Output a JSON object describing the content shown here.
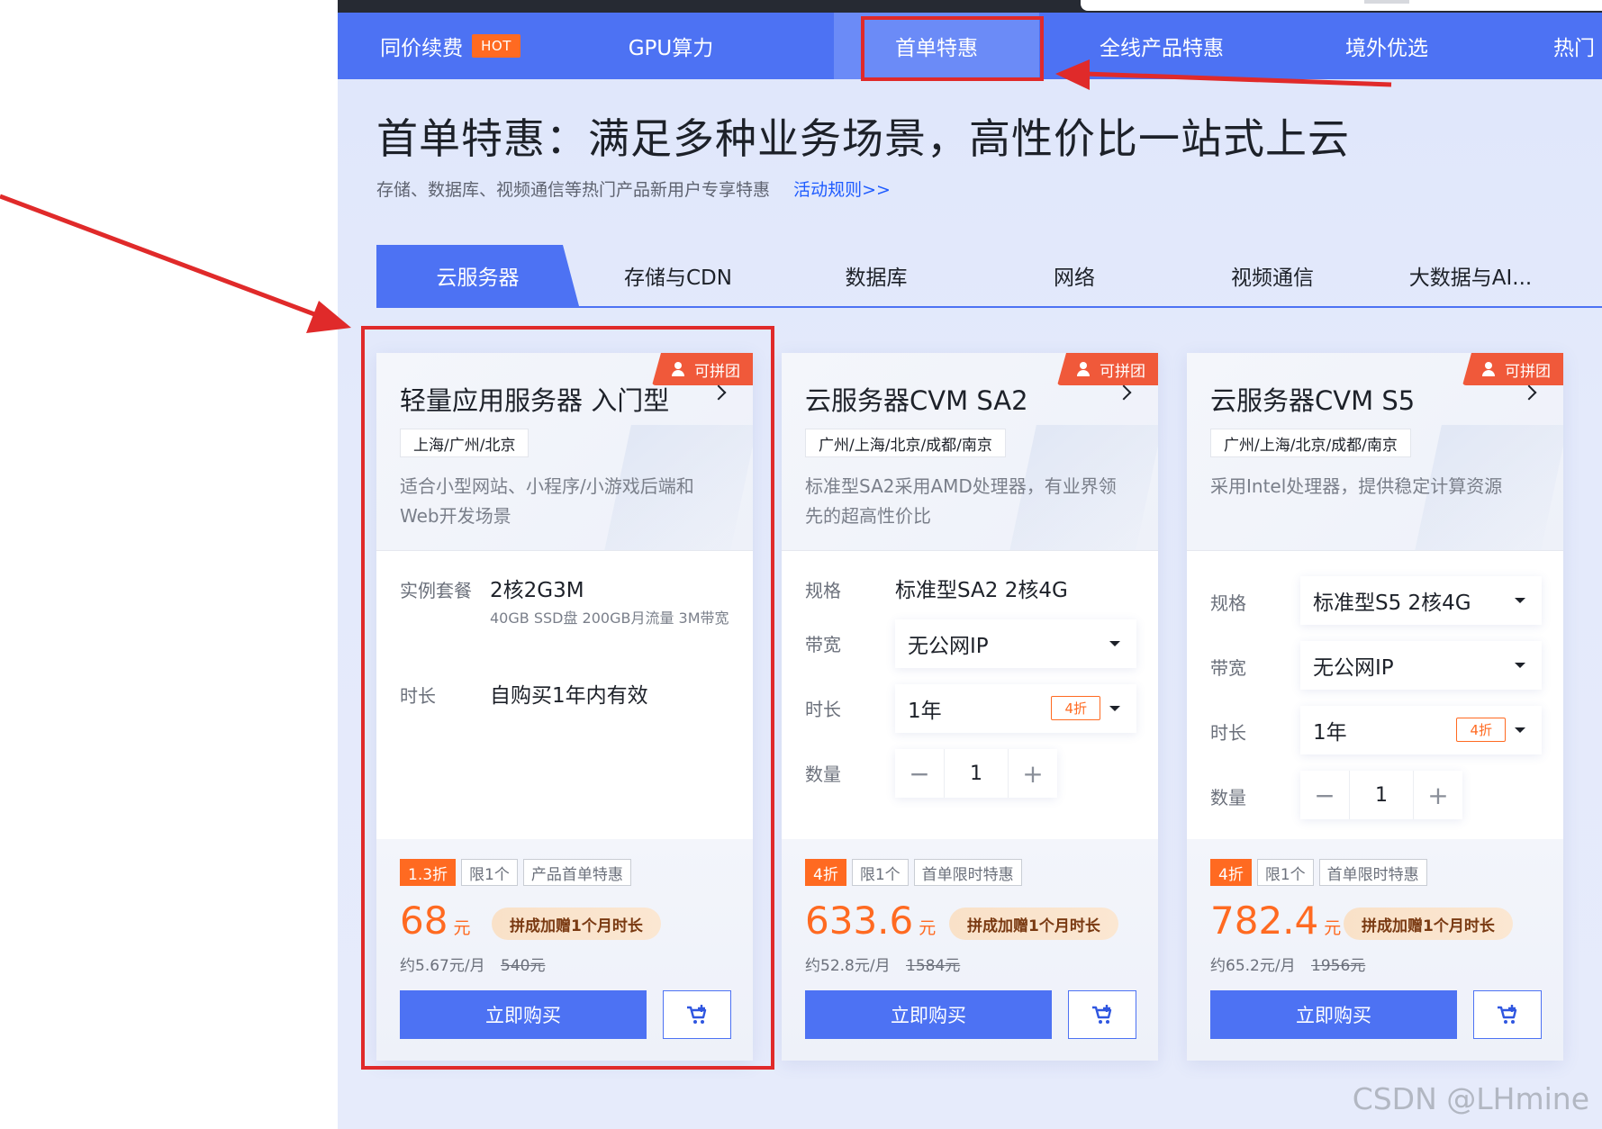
{
  "nav": {
    "items": [
      {
        "label": "同价续费",
        "badge": "HOT"
      },
      {
        "label": "GPU算力"
      },
      {
        "label": "首单特惠"
      },
      {
        "label": "全线产品特惠"
      },
      {
        "label": "境外优选"
      },
      {
        "label": "热门"
      }
    ]
  },
  "hero": {
    "title": "首单特惠：满足多种业务场景，高性价比一站式上云",
    "subtitle": "存储、数据库、视频通信等热门产品新用户专享特惠",
    "rules_link": "活动规则>>"
  },
  "tabs": [
    "云服务器",
    "存储与CDN",
    "数据库",
    "网络",
    "视频通信",
    "大数据与AI..."
  ],
  "cards": [
    {
      "group_tag": "可拼团",
      "title": "轻量应用服务器 入门型",
      "region": "上海/广州/北京",
      "desc": "适合小型网站、小程序/小游戏后端和Web开发场景",
      "package_label": "实例套餐",
      "package_value": "2核2G3M",
      "package_note": "40GB SSD盘 200GB月流量 3M带宽",
      "duration_label": "时长",
      "duration_value": "自购买1年内有效",
      "badges": [
        "1.3折",
        "限1个",
        "产品首单特惠"
      ],
      "price": "68",
      "price_unit": "元",
      "promo": "拼成加赠1个月时长",
      "monthly": "约5.67元/月",
      "original": "540元",
      "buy_label": "立即购买"
    },
    {
      "group_tag": "可拼团",
      "title": "云服务器CVM SA2",
      "region": "广州/上海/北京/成都/南京",
      "desc": "标准型SA2采用AMD处理器，有业界领先的超高性价比",
      "spec_label": "规格",
      "spec_value": "标准型SA2 2核4G",
      "bandwidth_label": "带宽",
      "bandwidth_value": "无公网IP",
      "duration_label": "时长",
      "duration_value": "1年",
      "duration_discount": "4折",
      "qty_label": "数量",
      "qty_value": "1",
      "badges": [
        "4折",
        "限1个",
        "首单限时特惠"
      ],
      "price": "633.6",
      "price_unit": "元",
      "promo": "拼成加赠1个月时长",
      "monthly": "约52.8元/月",
      "original": "1584元",
      "buy_label": "立即购买"
    },
    {
      "group_tag": "可拼团",
      "title": "云服务器CVM S5",
      "region": "广州/上海/北京/成都/南京",
      "desc": "采用Intel处理器，提供稳定计算资源",
      "spec_label": "规格",
      "spec_value": "标准型S5 2核4G",
      "bandwidth_label": "带宽",
      "bandwidth_value": "无公网IP",
      "duration_label": "时长",
      "duration_value": "1年",
      "duration_discount": "4折",
      "qty_label": "数量",
      "qty_value": "1",
      "badges": [
        "4折",
        "限1个",
        "首单限时特惠"
      ],
      "price": "782.4",
      "price_unit": "元",
      "promo": "拼成加赠1个月时长",
      "monthly": "约65.2元/月",
      "original": "1956元",
      "buy_label": "立即购买"
    }
  ],
  "watermark": "CSDN @LHmine",
  "colors": {
    "brand": "#4d72f3",
    "accent": "#ff6a21",
    "annotation": "#e02a2a"
  }
}
